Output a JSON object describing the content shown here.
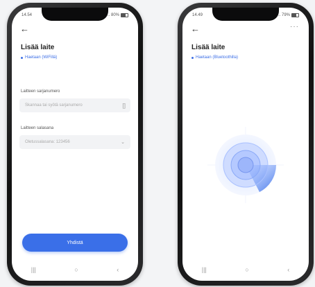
{
  "left_phone": {
    "status": {
      "time": "14.54",
      "right": " .. 80%"
    },
    "title": "Lisää laite",
    "mode": "Haetaan (WiFillä)",
    "serial": {
      "label": "Laitteen sarjanumero",
      "placeholder": "Skannaa tai syötä sarjanumero"
    },
    "password": {
      "label": "Laitteen salasana",
      "placeholder": "Oletussalasana: 123456"
    },
    "connect_label": "Yhdistä"
  },
  "right_phone": {
    "status": {
      "time": "14.49",
      "right": ".. 79%"
    },
    "title": "Lisää laite",
    "mode": "Haetaan (Bluetoothilla)",
    "more": "···"
  },
  "nav_icons": [
    "recent-apps-icon",
    "home-icon",
    "back-icon"
  ],
  "colors": {
    "accent": "#3a6fe8",
    "frame": "#111111"
  }
}
